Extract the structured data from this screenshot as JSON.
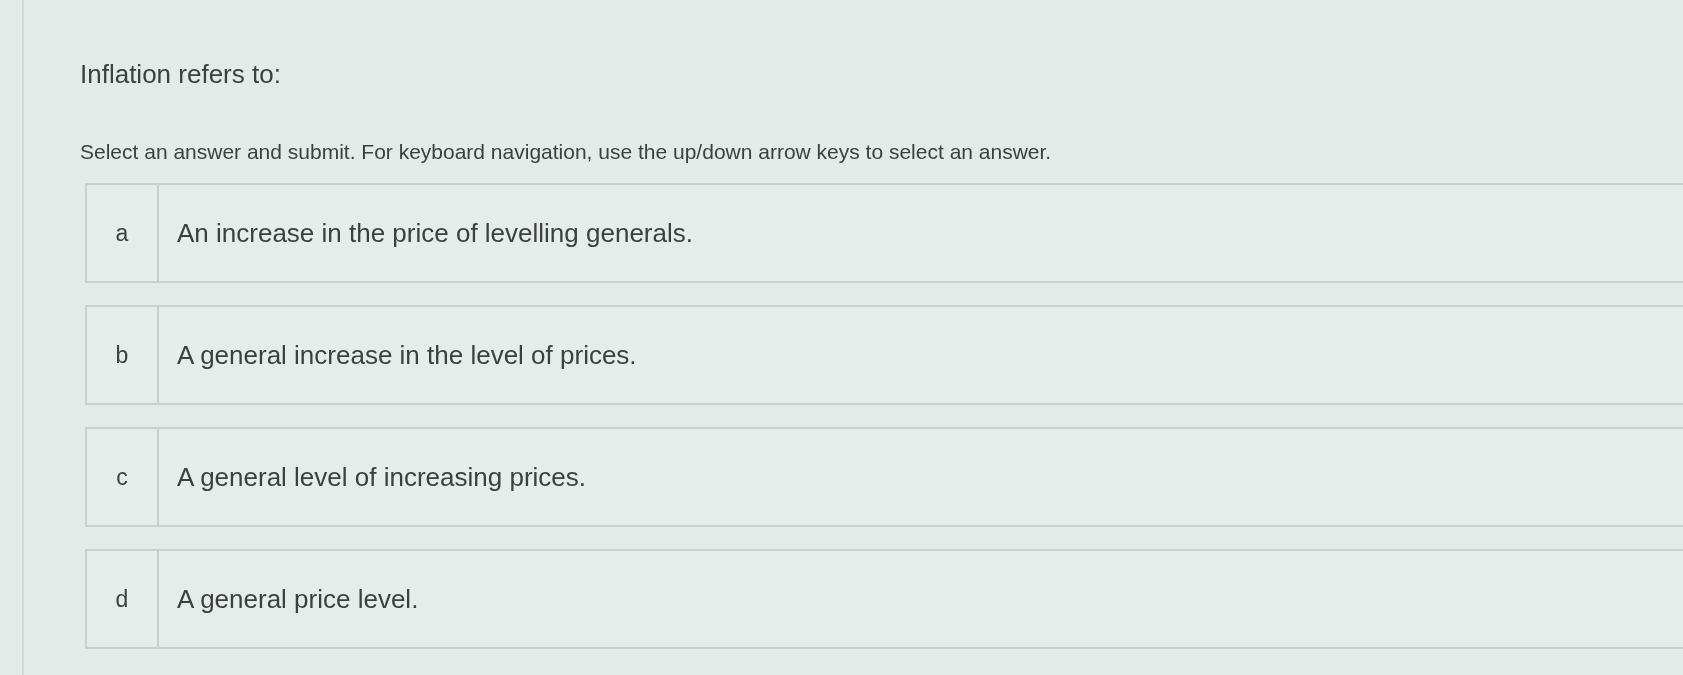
{
  "question": {
    "title": "Inflation refers to:",
    "instruction": "Select an answer and submit. For keyboard navigation, use the up/down arrow keys to select an answer."
  },
  "options": [
    {
      "letter": "a",
      "text": "An increase in the price of levelling generals.",
      "selected": false
    },
    {
      "letter": "b",
      "text": "A general increase in the level of prices.",
      "selected": false
    },
    {
      "letter": "c",
      "text": "A general level of increasing prices.",
      "selected": false
    },
    {
      "letter": "d",
      "text": "A general price level.",
      "selected": false
    }
  ]
}
